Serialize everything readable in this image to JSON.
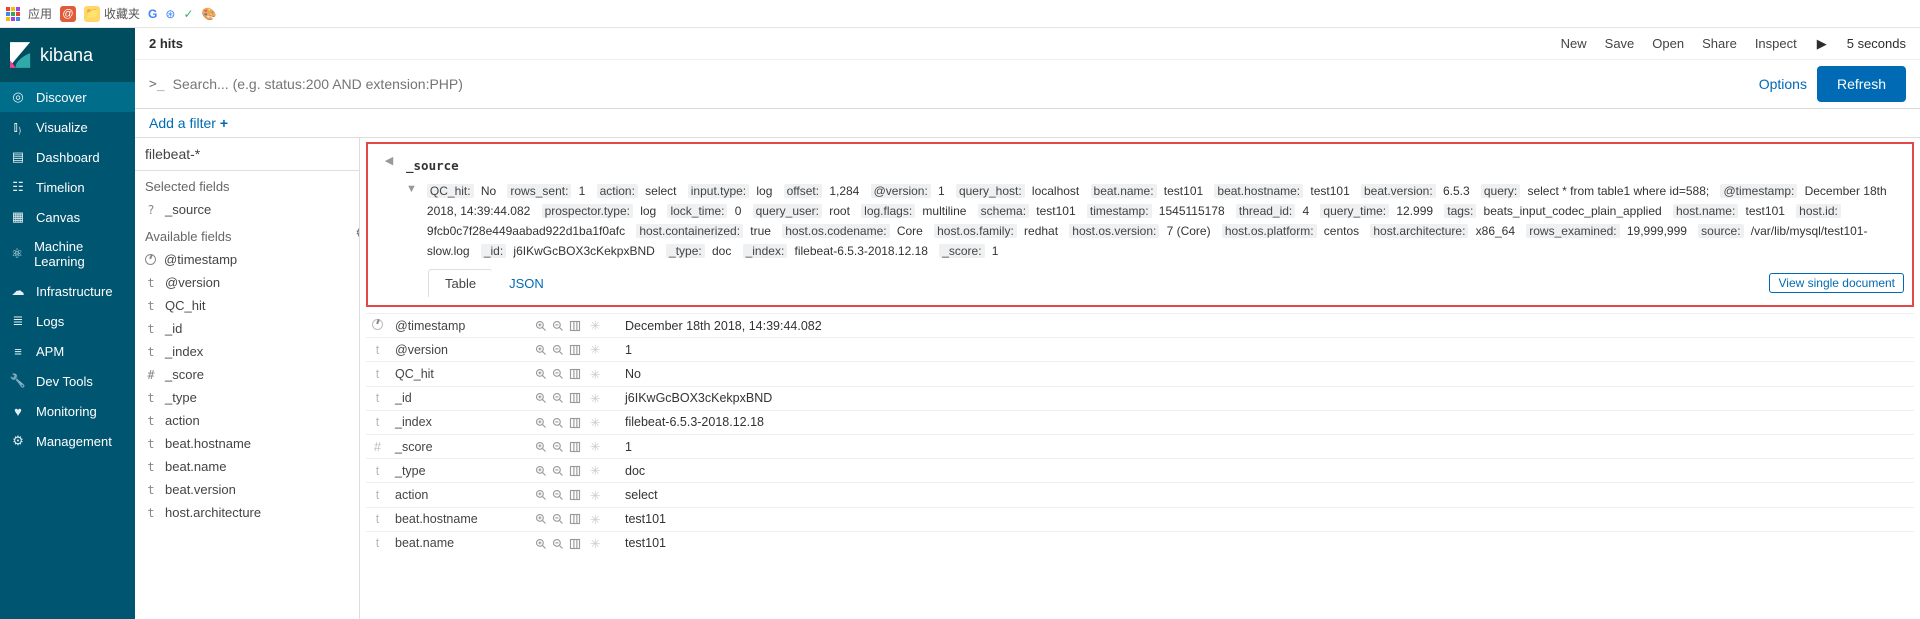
{
  "browser": {
    "apps_label": "应用",
    "bookmarks": [
      "@",
      "收藏夹",
      "G",
      "⊛",
      "✓",
      "✿"
    ]
  },
  "logo": "kibana",
  "nav": [
    "Discover",
    "Visualize",
    "Dashboard",
    "Timelion",
    "Canvas",
    "Machine Learning",
    "Infrastructure",
    "Logs",
    "APM",
    "Dev Tools",
    "Monitoring",
    "Management"
  ],
  "hits": "2 hits",
  "top_links": [
    "New",
    "Save",
    "Open",
    "Share",
    "Inspect"
  ],
  "interval": "5 seconds",
  "search_placeholder": "Search... (e.g. status:200 AND extension:PHP)",
  "options": "Options",
  "refresh": "Refresh",
  "add_filter": "Add a filter",
  "index_pattern": "filebeat-*",
  "selected_fields_h": "Selected fields",
  "source_field": "_source",
  "available_fields_h": "Available fields",
  "fields": [
    {
      "t": "c",
      "n": "@timestamp"
    },
    {
      "t": "t",
      "n": "@version"
    },
    {
      "t": "t",
      "n": "QC_hit"
    },
    {
      "t": "t",
      "n": "_id"
    },
    {
      "t": "t",
      "n": "_index"
    },
    {
      "t": "#",
      "n": "_score"
    },
    {
      "t": "t",
      "n": "_type"
    },
    {
      "t": "t",
      "n": "action"
    },
    {
      "t": "t",
      "n": "beat.hostname"
    },
    {
      "t": "t",
      "n": "beat.name"
    },
    {
      "t": "t",
      "n": "beat.version"
    },
    {
      "t": "t",
      "n": "host.architecture"
    }
  ],
  "source_label": "_source",
  "source": [
    {
      "k": "QC_hit:",
      "v": "No"
    },
    {
      "k": "rows_sent:",
      "v": "1"
    },
    {
      "k": "action:",
      "v": "select"
    },
    {
      "k": "input.type:",
      "v": "log"
    },
    {
      "k": "offset:",
      "v": "1,284"
    },
    {
      "k": "@version:",
      "v": "1"
    },
    {
      "k": "query_host:",
      "v": "localhost"
    },
    {
      "k": "beat.name:",
      "v": "test101"
    },
    {
      "k": "beat.hostname:",
      "v": "test101"
    },
    {
      "k": "beat.version:",
      "v": "6.5.3"
    },
    {
      "k": "query:",
      "v": "select * from table1 where id=588;"
    },
    {
      "k": "@timestamp:",
      "v": "December 18th 2018, 14:39:44.082"
    },
    {
      "k": "prospector.type:",
      "v": "log"
    },
    {
      "k": "lock_time:",
      "v": "0"
    },
    {
      "k": "query_user:",
      "v": "root"
    },
    {
      "k": "log.flags:",
      "v": "multiline"
    },
    {
      "k": "schema:",
      "v": "test101"
    },
    {
      "k": "timestamp:",
      "v": "1545115178"
    },
    {
      "k": "thread_id:",
      "v": "4"
    },
    {
      "k": "query_time:",
      "v": "12.999"
    },
    {
      "k": "tags:",
      "v": "beats_input_codec_plain_applied"
    },
    {
      "k": "host.name:",
      "v": "test101"
    },
    {
      "k": "host.id:",
      "v": "9fcb0c7f28e449aabad922d1ba1f0afc"
    },
    {
      "k": "host.containerized:",
      "v": "true"
    },
    {
      "k": "host.os.codename:",
      "v": "Core"
    },
    {
      "k": "host.os.family:",
      "v": "redhat"
    },
    {
      "k": "host.os.version:",
      "v": "7 (Core)"
    },
    {
      "k": "host.os.platform:",
      "v": "centos"
    },
    {
      "k": "host.architecture:",
      "v": "x86_64"
    },
    {
      "k": "rows_examined:",
      "v": "19,999,999"
    },
    {
      "k": "source:",
      "v": "/var/lib/mysql/test101-slow.log"
    },
    {
      "k": "_id:",
      "v": "j6IKwGcBOX3cKekpxBND"
    },
    {
      "k": "_type:",
      "v": "doc"
    },
    {
      "k": "_index:",
      "v": "filebeat-6.5.3-2018.12.18"
    },
    {
      "k": "_score:",
      "v": "1"
    }
  ],
  "tabs": {
    "table": "Table",
    "json": "JSON"
  },
  "view_doc": "View single document",
  "rows": [
    {
      "t": "c",
      "f": "@timestamp",
      "v": "December 18th 2018, 14:39:44.082"
    },
    {
      "t": "t",
      "f": "@version",
      "v": "1"
    },
    {
      "t": "t",
      "f": "QC_hit",
      "v": "No"
    },
    {
      "t": "t",
      "f": "_id",
      "v": "j6IKwGcBOX3cKekpxBND"
    },
    {
      "t": "t",
      "f": "_index",
      "v": "filebeat-6.5.3-2018.12.18"
    },
    {
      "t": "#",
      "f": "_score",
      "v": "1"
    },
    {
      "t": "t",
      "f": "_type",
      "v": "doc"
    },
    {
      "t": "t",
      "f": "action",
      "v": "select"
    },
    {
      "t": "t",
      "f": "beat.hostname",
      "v": "test101"
    },
    {
      "t": "t",
      "f": "beat.name",
      "v": "test101"
    }
  ]
}
